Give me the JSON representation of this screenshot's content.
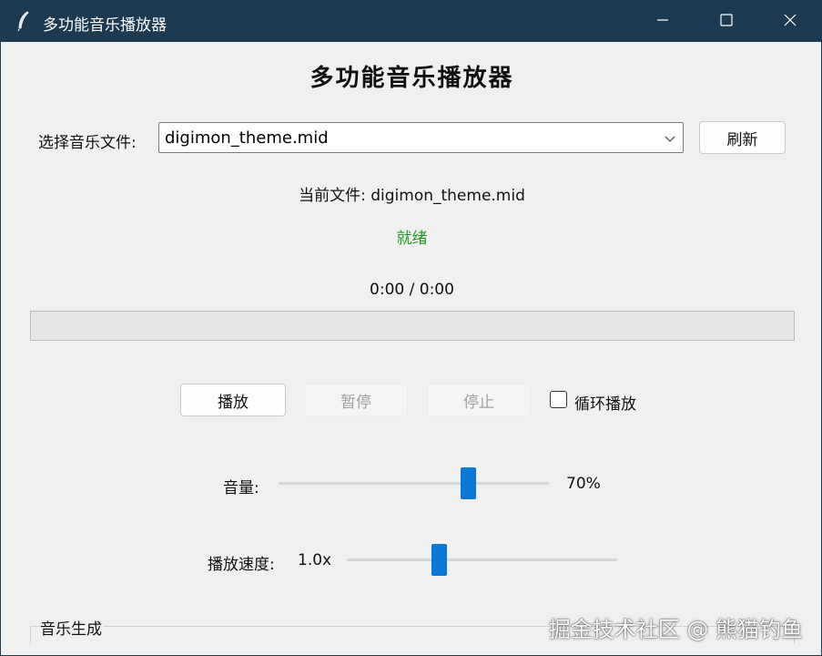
{
  "window": {
    "title": "多功能音乐播放器",
    "titlebar_color": "#1c3a52"
  },
  "main": {
    "heading": "多功能音乐播放器",
    "file_select_label": "选择音乐文件:",
    "file_select_value": "digimon_theme.mid",
    "refresh_label": "刷新",
    "current_file_text": "当前文件: digimon_theme.mid",
    "status_text": "就绪",
    "status_color": "#1f9a1f",
    "time_text": "0:00 / 0:00",
    "progress_percent": 0,
    "play_label": "播放",
    "pause_label": "暂停",
    "stop_label": "停止",
    "loop_label": "循环播放",
    "loop_checked": false,
    "volume_label": "音量:",
    "volume_value": 0.7,
    "volume_text": "70%",
    "speed_label": "播放速度:",
    "speed_text": "1.0x",
    "speed_fraction": 0.34,
    "music_gen_label": "音乐生成"
  },
  "watermark": "掘金技术社区 @ 熊猫钓鱼",
  "icons": {
    "app": "feather-icon",
    "minimize": "minimize-icon",
    "maximize": "maximize-icon",
    "close": "close-icon",
    "dropdown": "chevron-down-icon"
  },
  "accent_color": "#0a78d7"
}
